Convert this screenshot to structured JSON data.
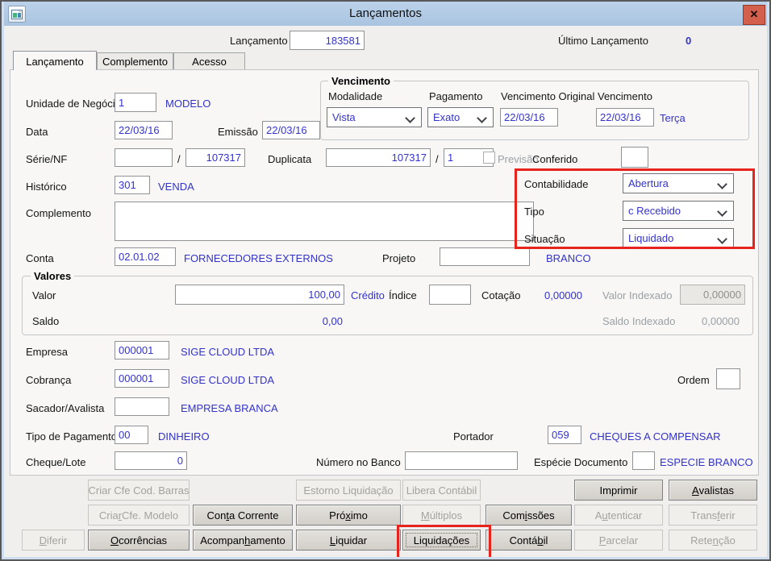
{
  "window": {
    "title": "Lançamentos",
    "close_glyph": "✕"
  },
  "header": {
    "lancamento_label": "Lançamento",
    "lancamento_value": "183581",
    "ultimo_label": "Último Lançamento",
    "ultimo_value": "0"
  },
  "tabs": [
    {
      "label": "Lançamento",
      "active": true
    },
    {
      "label": "Complemento",
      "active": false
    },
    {
      "label": "Acesso",
      "active": false
    }
  ],
  "vencimento_group": {
    "title": "Vencimento",
    "modalidade": {
      "label": "Modalidade",
      "value": "Vista"
    },
    "pagamento": {
      "label": "Pagamento",
      "value": "Exato"
    },
    "vencimento_original": {
      "label": "Vencimento Original",
      "value": "22/03/16"
    },
    "vencimento": {
      "label": "Vencimento",
      "value": "22/03/16",
      "weekday": "Terça"
    }
  },
  "fields": {
    "unidade": {
      "label": "Unidade de Negócio",
      "value": "1",
      "desc": "MODELO"
    },
    "data": {
      "label": "Data",
      "value": "22/03/16"
    },
    "emissao": {
      "label": "Emissão",
      "value": "22/03/16"
    },
    "serie_nf": {
      "label": "Série/NF",
      "serie": "",
      "slash": "/",
      "nf": "107317"
    },
    "duplicata": {
      "label": "Duplicata",
      "value": "107317",
      "slash": "/",
      "parcela": "1"
    },
    "previsao": {
      "label": "Previsão"
    },
    "conferido": {
      "label": "Conferido",
      "value": ""
    },
    "historico": {
      "label": "Histórico",
      "value": "301",
      "desc": "VENDA"
    },
    "complemento": {
      "label": "Complemento",
      "value": ""
    },
    "conta": {
      "label": "Conta",
      "value": "02.01.02",
      "desc": "FORNECEDORES EXTERNOS"
    },
    "projeto": {
      "label": "Projeto",
      "value": "",
      "desc": "BRANCO"
    },
    "empresa": {
      "label": "Empresa",
      "value": "000001",
      "desc": "SIGE CLOUD LTDA"
    },
    "cobranca": {
      "label": "Cobrança",
      "value": "000001",
      "desc": "SIGE CLOUD LTDA"
    },
    "ordem": {
      "label": "Ordem",
      "value": ""
    },
    "sacador": {
      "label": "Sacador/Avalista",
      "value": "",
      "desc": "EMPRESA BRANCA"
    },
    "tipo_pagamento": {
      "label": "Tipo de Pagamento",
      "value": "00",
      "desc": "DINHEIRO"
    },
    "portador": {
      "label": "Portador",
      "value": "059",
      "desc": "CHEQUES A COMPENSAR"
    },
    "cheque_lote": {
      "label": "Cheque/Lote",
      "value": "0"
    },
    "numero_banco": {
      "label": "Número no Banco",
      "value": ""
    },
    "especie": {
      "label": "Espécie Documento",
      "value": "",
      "desc": "ESPECIE BRANCO"
    }
  },
  "classificacao": {
    "contabilidade": {
      "label": "Contabilidade",
      "value": "Abertura"
    },
    "tipo": {
      "label": "Tipo",
      "value": "c Recebido"
    },
    "situacao": {
      "label": "Situação",
      "value": "Liquidado"
    }
  },
  "valores_group": {
    "title": "Valores",
    "valor": {
      "label": "Valor",
      "value": "100,00",
      "desc": "Crédito"
    },
    "indice": {
      "label": "Índice",
      "value": ""
    },
    "cotacao": {
      "label": "Cotação",
      "value": "0,00000"
    },
    "valor_indexado": {
      "label": "Valor Indexado",
      "value": "0,00000"
    },
    "saldo": {
      "label": "Saldo",
      "value": "0,00"
    },
    "saldo_indexado": {
      "label": "Saldo Indexado",
      "value": "0,00000"
    }
  },
  "buttons": {
    "criar_cod_barras": {
      "label": "Criar Cfe Cod. Barras",
      "underline": -1,
      "enabled": false
    },
    "estorno_liquidacao": {
      "label": "Estorno Liquidação",
      "underline": -1,
      "enabled": false
    },
    "libera_contabil": {
      "label": "Libera Contábil",
      "underline": -1,
      "enabled": false
    },
    "imprimir": {
      "label": "Imprimir",
      "underline": -1,
      "enabled": true
    },
    "avalistas": {
      "label": "Avalistas",
      "underline": 0,
      "enabled": true
    },
    "criar_modelo": {
      "label": "Criar Cfe. Modelo",
      "underline": 4,
      "enabled": false
    },
    "conta_corrente": {
      "label": "Conta Corrente",
      "underline": 3,
      "enabled": true
    },
    "proximo": {
      "label": "Próximo",
      "underline": 3,
      "enabled": true
    },
    "multiplos": {
      "label": "Múltiplos",
      "underline": 0,
      "enabled": false
    },
    "comissoes": {
      "label": "Comissões",
      "underline": 3,
      "enabled": true
    },
    "autenticar": {
      "label": "Autenticar",
      "underline": 1,
      "enabled": false
    },
    "transferir": {
      "label": "Transferir",
      "underline": 5,
      "enabled": false
    },
    "diferir": {
      "label": "Diferir",
      "underline": 0,
      "enabled": false
    },
    "ocorrencias": {
      "label": "Ocorrências",
      "underline": 0,
      "enabled": true
    },
    "acompanhamento": {
      "label": "Acompanhamento",
      "underline": 7,
      "enabled": true
    },
    "liquidar": {
      "label": "Liquidar",
      "underline": 0,
      "enabled": true
    },
    "liquidacoes": {
      "label": "Liquidações",
      "underline": -1,
      "enabled": true,
      "focused": true
    },
    "contabil": {
      "label": "Contábil",
      "underline": 5,
      "enabled": true
    },
    "parcelar": {
      "label": "Parcelar",
      "underline": 0,
      "enabled": false
    },
    "retencao": {
      "label": "Retenção",
      "underline": 4,
      "enabled": false
    }
  },
  "colors": {
    "value_blue": "#3333cc",
    "annotation_red": "#e6231d",
    "titlebar_blue": "#b3cbe5",
    "close_button_red": "#d2604d"
  }
}
